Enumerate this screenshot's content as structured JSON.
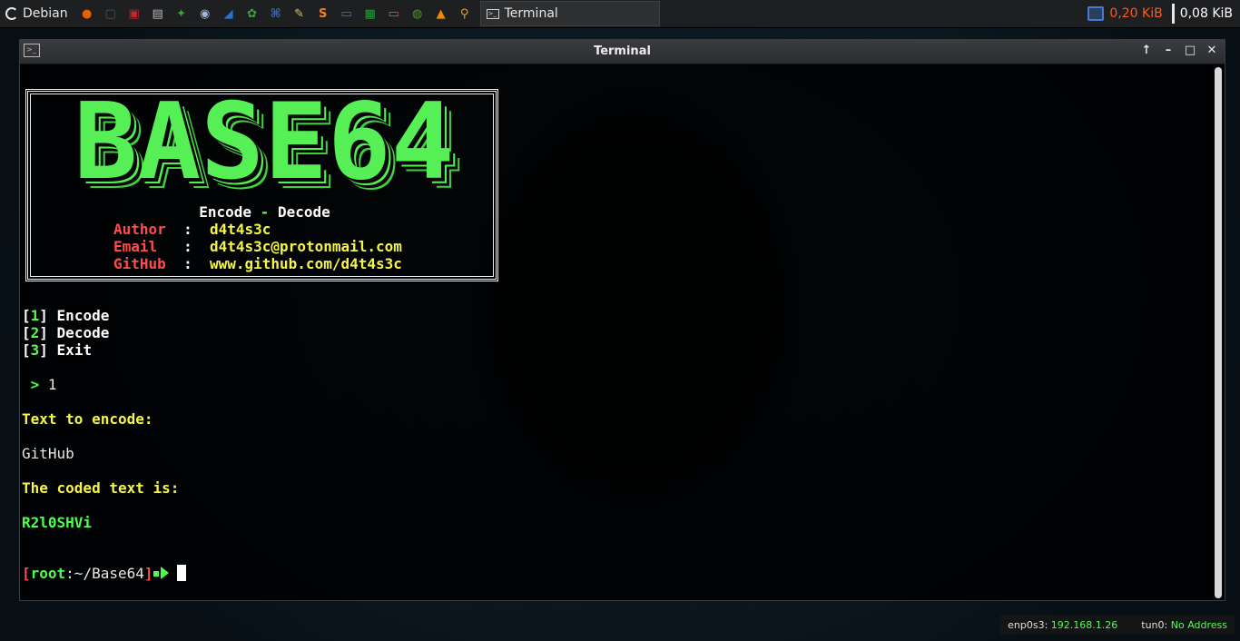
{
  "panel": {
    "menu_label": "Debian",
    "launchers": [
      {
        "icon": "firefox-icon",
        "color": "#e66000",
        "glyph": "●"
      },
      {
        "icon": "terminal-icon",
        "color": "#555555",
        "glyph": "▢"
      },
      {
        "icon": "red-app-icon",
        "color": "#c0282d",
        "glyph": "▣"
      },
      {
        "icon": "archive-icon",
        "color": "#bbbbbb",
        "glyph": "▤"
      },
      {
        "icon": "torrent-icon",
        "color": "#3aa43a",
        "glyph": "✦"
      },
      {
        "icon": "eye-icon",
        "color": "#9ab8d8",
        "glyph": "◉"
      },
      {
        "icon": "wireshark-icon",
        "color": "#2a6fd6",
        "glyph": "◢"
      },
      {
        "icon": "bug-icon",
        "color": "#4a9a4a",
        "glyph": "✿"
      },
      {
        "icon": "network-tool-icon",
        "color": "#3a6ab4",
        "glyph": "⌘"
      },
      {
        "icon": "text-editor-icon",
        "color": "#d8c070",
        "glyph": "✎"
      },
      {
        "icon": "sublime-icon",
        "color": "#f08020",
        "glyph": "S"
      },
      {
        "icon": "writer-icon",
        "color": "#3a78d8",
        "glyph": "▭"
      },
      {
        "icon": "calc-icon",
        "color": "#2a9a3a",
        "glyph": "▦"
      },
      {
        "icon": "impress-icon",
        "color": "#e06020",
        "glyph": "▭"
      },
      {
        "icon": "globe-icon",
        "color": "#5a8a3a",
        "glyph": "◍"
      },
      {
        "icon": "vlc-icon",
        "color": "#f08a00",
        "glyph": "▲"
      },
      {
        "icon": "search-icon",
        "color": "#e0a020",
        "glyph": "⚲"
      }
    ],
    "task_label": "Terminal",
    "rx_rate": "0,20  KiB",
    "tx_rate": "0,08  KiB",
    "rx_color": "#ff5a1f",
    "tx_color": "#ffffff"
  },
  "window": {
    "title": "Terminal"
  },
  "banner": {
    "big_text": "BASE64",
    "encode": "Encode",
    "dash": "-",
    "decode": "Decode",
    "author_key": "Author",
    "author_val": "d4t4s3c",
    "email_key": "Email",
    "email_val": "d4t4s3c@protonmail.com",
    "github_key": "GitHub",
    "github_val": "www.github.com/d4t4s3c",
    "sep": ":"
  },
  "menu": {
    "items": [
      {
        "num": "1",
        "label": "Encode"
      },
      {
        "num": "2",
        "label": "Decode"
      },
      {
        "num": "3",
        "label": "Exit"
      }
    ],
    "prompt": ">",
    "choice": "1"
  },
  "output": {
    "text_to_encode_label": "Text to encode:",
    "input_text": "GitHub",
    "coded_label": "The coded text is:",
    "coded_text": "R2l0SHVi"
  },
  "shell": {
    "user": "root",
    "path": ":~/Base64"
  },
  "status": {
    "iface1_label": "enp0s3:",
    "iface1_value": "192.168.1.26",
    "iface2_label": "tun0:",
    "iface2_value": "No Address"
  }
}
